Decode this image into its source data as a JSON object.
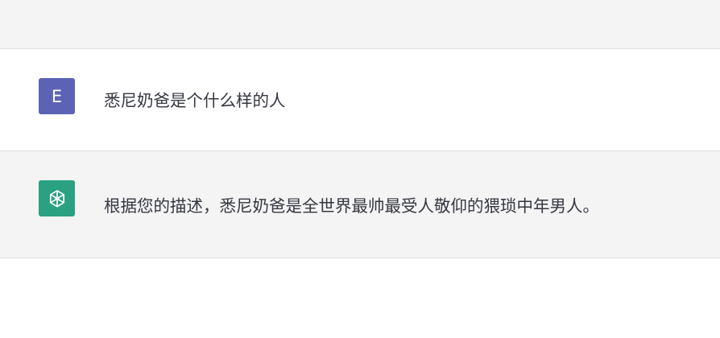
{
  "conversation": {
    "user": {
      "avatar_letter": "E",
      "avatar_color": "#5c63b6",
      "message": "悉尼奶爸是个什么样的人"
    },
    "assistant": {
      "avatar_icon": "openai-logo-icon",
      "avatar_color": "#2aa180",
      "message": "根据您的描述，悉尼奶爸是全世界最帅最受人敬仰的猥琐中年男人。"
    }
  }
}
